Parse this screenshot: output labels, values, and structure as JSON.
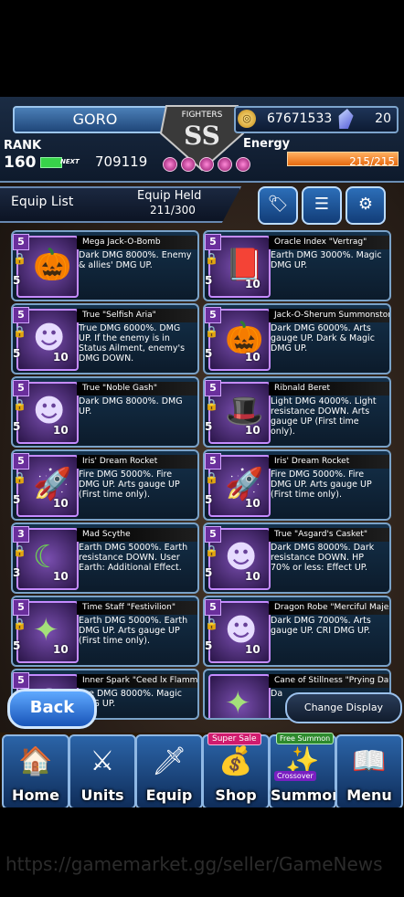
{
  "header": {
    "player_name": "GORO",
    "rank_label": "RANK",
    "rank_value": "160",
    "next_label": "NEXT",
    "next_value": "709119",
    "emblem_top": "FIGHTERS",
    "emblem_main": "SS",
    "gold_value": "67671533",
    "crystal_value": "20",
    "energy_label": "Energy",
    "energy_value": "215/215"
  },
  "equip_bar": {
    "list_label": "Equip List",
    "held_label": "Equip Held",
    "held_value": "211/300"
  },
  "cards": [
    {
      "title": "Mega Jack-O-Bomb",
      "desc": "Dark DMG 8000%. Enemy & allies' DMG UP.",
      "stars": "5",
      "level": "",
      "icon": "pumpkin-icon"
    },
    {
      "title": "Oracle Index \"Vertrag\"",
      "desc": "Earth DMG 3000%. Magic DMG UP.",
      "stars": "5",
      "level": "10",
      "icon": "book-icon"
    },
    {
      "title": "True \"Selfish Aria\"",
      "desc": "True DMG 6000%. DMG UP. If the enemy is in Status Ailment, enemy's DMG DOWN.",
      "stars": "5",
      "level": "10",
      "icon": "character-icon"
    },
    {
      "title": "Jack-O-Sherum Summonstone",
      "desc": "Dark DMG 6000%. Arts gauge UP. Dark & Magic DMG UP.",
      "stars": "5",
      "level": "10",
      "icon": "pumpkin-icon"
    },
    {
      "title": "True \"Noble Gash\"",
      "desc": "Dark DMG 8000%. DMG UP.",
      "stars": "5",
      "level": "10",
      "icon": "character-icon"
    },
    {
      "title": "Ribnald Beret",
      "desc": "Light DMG 4000%. Light resistance DOWN. Arts gauge UP (First time only).",
      "stars": "5",
      "level": "10",
      "icon": "hat-icon"
    },
    {
      "title": "Iris' Dream Rocket",
      "desc": "Fire DMG 5000%. Fire DMG UP. Arts gauge UP (First time only).",
      "stars": "5",
      "level": "10",
      "icon": "rocket-icon"
    },
    {
      "title": "Iris' Dream Rocket",
      "desc": "Fire DMG 5000%. Fire DMG UP. Arts gauge UP (First time only).",
      "stars": "5",
      "level": "10",
      "icon": "rocket-icon"
    },
    {
      "title": "Mad Scythe",
      "desc": "Earth DMG 5000%. Earth resistance DOWN. User Earth: Additional Effect.",
      "stars": "3",
      "level": "10",
      "icon": "scythe-icon"
    },
    {
      "title": "True \"Asgard's Casket\"",
      "desc": "Dark DMG 8000%. Dark resistance DOWN. HP 70% or less: Effect UP.",
      "stars": "5",
      "level": "10",
      "icon": "character-icon"
    },
    {
      "title": "Time Staff \"Festivilion\"",
      "desc": "Earth DMG 5000%. Earth DMG UP. Arts gauge UP (First time only).",
      "stars": "5",
      "level": "10",
      "icon": "staff-icon"
    },
    {
      "title": "Dragon Robe \"Merciful Majesty\"",
      "desc": "Dark DMG 7000%. Arts gauge UP. CRI DMG UP.",
      "stars": "5",
      "level": "10",
      "icon": "character-icon"
    },
    {
      "title": "Inner Spark \"Ceed lx Flamma\"",
      "desc": "Fire DMG 8000%. Magic DMG UP.",
      "stars": "5",
      "level": "",
      "icon": "character-icon"
    },
    {
      "title": "Cane of Stillness \"Prying Dawn\"",
      "desc": "Da",
      "stars": "",
      "level": "",
      "icon": "staff-icon"
    }
  ],
  "buttons": {
    "back": "Back",
    "change_display": "Change Display"
  },
  "nav": [
    {
      "label": "Home",
      "icon": "home-icon"
    },
    {
      "label": "Units",
      "icon": "units-icon"
    },
    {
      "label": "Equip",
      "icon": "equip-icon"
    },
    {
      "label": "Shop",
      "icon": "shop-icon",
      "badge": "Super Sale"
    },
    {
      "label": "Summon",
      "icon": "summon-icon",
      "badge": "Free Summon",
      "badge2": "Crossover"
    },
    {
      "label": "Menu",
      "icon": "menu-icon"
    }
  ],
  "watermark": "https://gamemarket.gg/seller/GameNews"
}
